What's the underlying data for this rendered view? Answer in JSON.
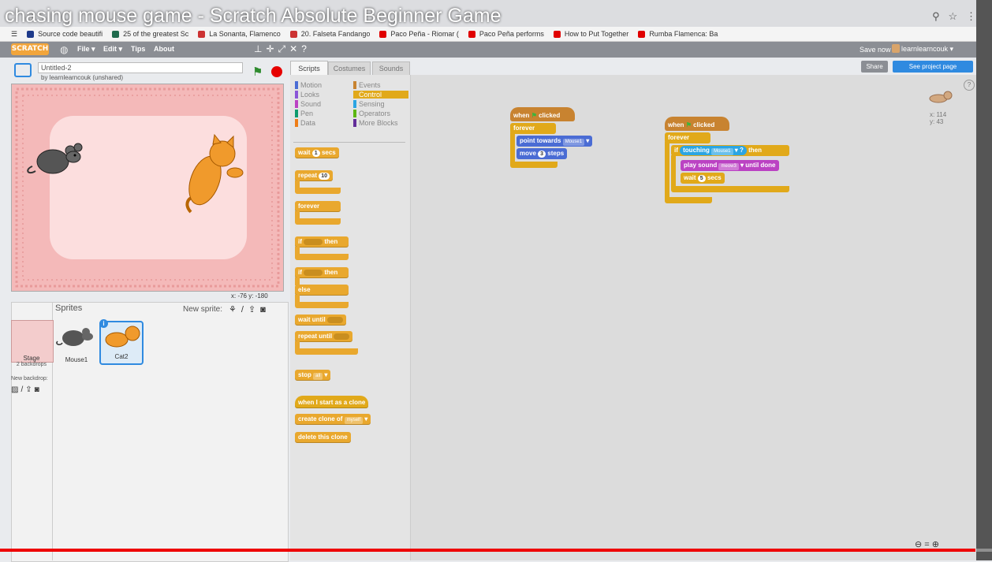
{
  "video": {
    "title": "chasing mouse game - Scratch Absolute Beginner Game",
    "progress": 0.983
  },
  "bookmarks": [
    {
      "label": "Source code beautifi",
      "color": "#1e3a8a"
    },
    {
      "label": "25 of the greatest Sc",
      "color": "#1f6b4d"
    },
    {
      "label": "La Sonanta, Flamenco",
      "color": "#cc3333"
    },
    {
      "label": "20. Falseta Fandango",
      "color": "#cc3333"
    },
    {
      "label": "Paco Peña - Riomar (",
      "color": "#e00000"
    },
    {
      "label": "Paco Peña performs",
      "color": "#e00000"
    },
    {
      "label": "How to Put Together",
      "color": "#e00000"
    },
    {
      "label": "Rumba Flamenca: Ba",
      "color": "#e00000"
    }
  ],
  "menubar": {
    "logo": "SCRATCH",
    "items": [
      "File ▾",
      "Edit ▾",
      "Tips",
      "About"
    ],
    "save_now": "Save now",
    "user": "learnlearncouk ▾"
  },
  "project": {
    "title": "Untitled-2",
    "author": "by learnlearncouk (unshared)"
  },
  "stage": {
    "coords": "x: -76   y: -180"
  },
  "sprites": {
    "heading": "Sprites",
    "new_sprite": "New sprite:",
    "stage_label": "Stage",
    "backdrops": "2 backdrops",
    "new_backdrop": "New backdrop:",
    "list": [
      {
        "name": "Mouse1"
      },
      {
        "name": "Cat2"
      }
    ]
  },
  "tabs": [
    "Scripts",
    "Costumes",
    "Sounds"
  ],
  "categories": [
    {
      "name": "Motion",
      "color": "#4a6cd4"
    },
    {
      "name": "Events",
      "color": "#c88330"
    },
    {
      "name": "Looks",
      "color": "#8a55d7"
    },
    {
      "name": "Control",
      "color": "#e1a91a"
    },
    {
      "name": "Sound",
      "color": "#bb42c3"
    },
    {
      "name": "Sensing",
      "color": "#2ca5e2"
    },
    {
      "name": "Pen",
      "color": "#0e9a6c"
    },
    {
      "name": "Operators",
      "color": "#5cb712"
    },
    {
      "name": "Data",
      "color": "#ee7d16"
    },
    {
      "name": "More Blocks",
      "color": "#632d99"
    }
  ],
  "palette": {
    "wait": "wait",
    "wait_num": "1",
    "secs": "secs",
    "repeat": "repeat",
    "repeat_num": "10",
    "forever": "forever",
    "if": "if",
    "then": "then",
    "else": "else",
    "wait_until": "wait until",
    "repeat_until": "repeat until",
    "stop": "stop",
    "stop_opt": "all",
    "clone_hat": "when I start as a clone",
    "create_clone": "create clone of",
    "clone_opt": "myself",
    "delete_clone": "delete this clone"
  },
  "toolbar": {
    "share": "Share",
    "see_project": "See project page"
  },
  "script1": {
    "hat": "when",
    "clicked": "clicked",
    "forever": "forever",
    "point": "point towards",
    "point_target": "Mouse1",
    "move": "move",
    "move_num": "3",
    "steps": "steps"
  },
  "script2": {
    "hat": "when",
    "clicked": "clicked",
    "forever": "forever",
    "if": "if",
    "touching": "touching",
    "touch_target": "Mouse1",
    "q": "?",
    "then": "then",
    "play": "play sound",
    "sound": "meow3",
    "until_done": "until done",
    "wait": "wait",
    "wait_num": "5",
    "secs": "secs"
  },
  "sprite_info": {
    "x": "x: 114",
    "y": "y: 43"
  }
}
